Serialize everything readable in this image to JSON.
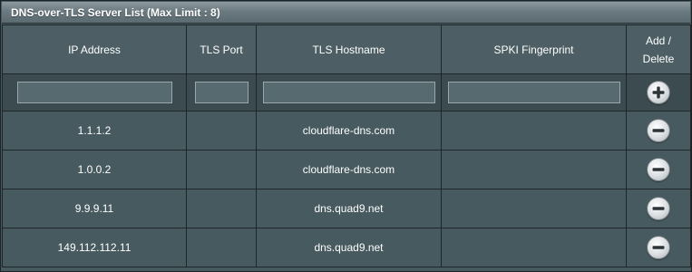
{
  "panel": {
    "title": "DNS-over-TLS Server List (Max Limit : 8)"
  },
  "table": {
    "headers": {
      "ip_address": "IP Address",
      "tls_port": "TLS Port",
      "tls_hostname": "TLS Hostname",
      "spki_fingerprint": "SPKI Fingerprint",
      "add_delete_line1": "Add /",
      "add_delete_line2": "Delete"
    },
    "input_row": {
      "ip_address": "",
      "tls_port": "",
      "tls_hostname": "",
      "spki_fingerprint": "",
      "add_icon": "plus-circle-icon"
    },
    "rows": [
      {
        "ip_address": "1.1.1.2",
        "tls_port": "",
        "tls_hostname": "cloudflare-dns.com",
        "spki_fingerprint": "",
        "delete_icon": "minus-circle-icon"
      },
      {
        "ip_address": "1.0.0.2",
        "tls_port": "",
        "tls_hostname": "cloudflare-dns.com",
        "spki_fingerprint": "",
        "delete_icon": "minus-circle-icon"
      },
      {
        "ip_address": "9.9.9.11",
        "tls_port": "",
        "tls_hostname": "dns.quad9.net",
        "spki_fingerprint": "",
        "delete_icon": "minus-circle-icon"
      },
      {
        "ip_address": "149.112.112.11",
        "tls_port": "",
        "tls_hostname": "dns.quad9.net",
        "spki_fingerprint": "",
        "delete_icon": "minus-circle-icon"
      }
    ]
  },
  "colors": {
    "panel_bg": "#475a5f",
    "input_row_bg": "#3c4b50",
    "grid_line": "#1f2629",
    "text": "#ffffff"
  }
}
